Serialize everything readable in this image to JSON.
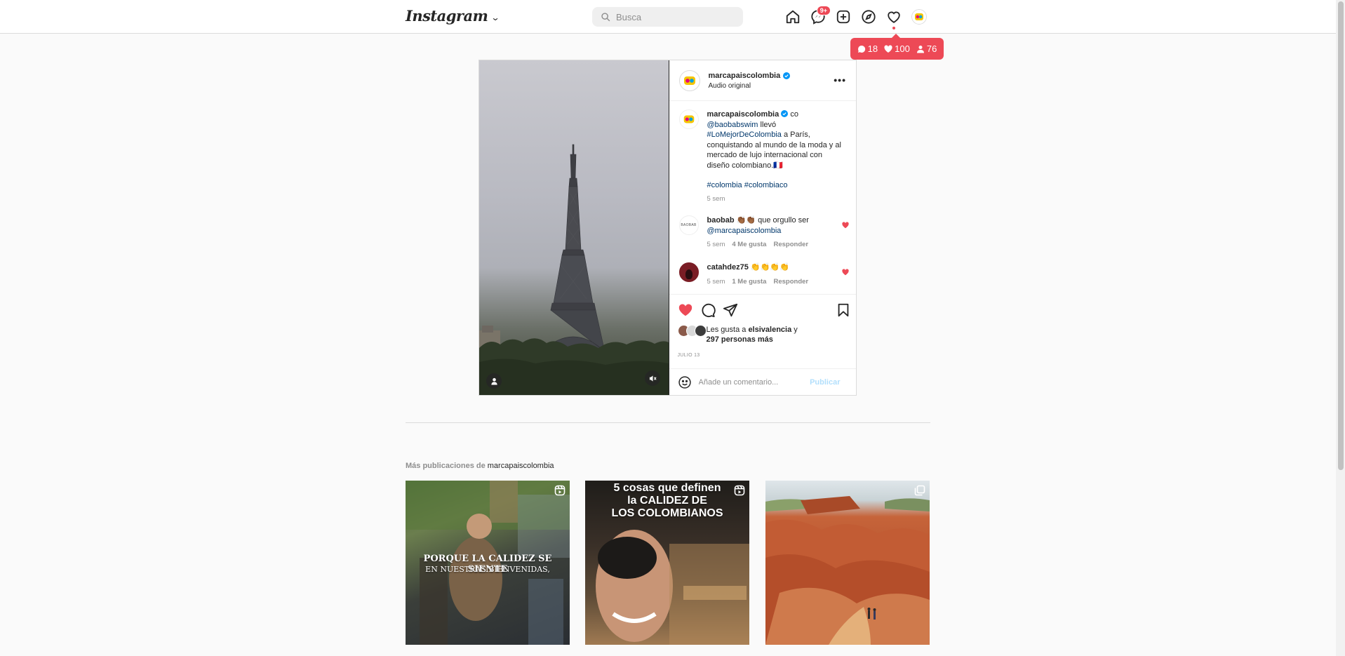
{
  "nav": {
    "logo": "Instagram",
    "search_placeholder": "Busca",
    "messages_badge": "9+"
  },
  "notifications": {
    "comments": "18",
    "likes": "100",
    "followers": "76"
  },
  "post": {
    "username": "marcapaiscolombia",
    "subtitle": "Audio original",
    "caption": {
      "username": "marcapaiscolombia",
      "flag": "co",
      "mention": "@baobabswim",
      "text1": " llevó ",
      "hashtag1": "#LoMejorDeColombia",
      "text2": " a París, conquistando al mundo de la moda y al mercado de lujo internacional con diseño colombiano.🇫🇷",
      "hashtags": "#colombia #colombiaco",
      "time": "5 sem"
    },
    "comments": [
      {
        "username": "baobab",
        "emoji": "👏🏾👏🏾",
        "text": " que orgullo ser ",
        "mention": "@marcapaiscolombia",
        "time": "5 sem",
        "likes": "4 Me gusta",
        "reply": "Responder"
      },
      {
        "username": "catahdez75",
        "emoji": "👏👏👏👏",
        "text": "",
        "time": "5 sem",
        "likes": "1 Me gusta",
        "reply": "Responder"
      }
    ],
    "likes_prefix": "Les gusta a ",
    "likes_user": "elsivalencia",
    "likes_mid": " y",
    "likes_count": "297 personas más",
    "date": "JULIO 13",
    "comment_placeholder": "Añade un comentario...",
    "publish": "Publicar"
  },
  "more_posts": {
    "label": "Más publicaciones de ",
    "user": "marcapaiscolombia",
    "items": [
      {
        "line1": "PORQUE LA CALIDEZ SE SIENTE",
        "line2": "EN NUESTRAS BIENVENIDAS,"
      },
      {
        "line1": "5 cosas que definen",
        "line2": "la CALIDEZ DE",
        "line3": "LOS COLOMBIANOS"
      },
      {
        "line1": ""
      }
    ]
  }
}
